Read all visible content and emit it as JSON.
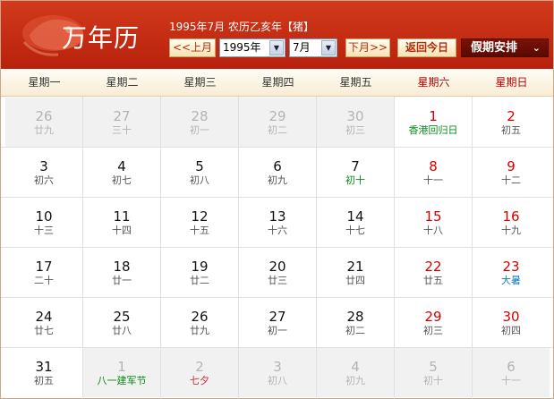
{
  "header": {
    "logo_text": "万年历",
    "info_line": "1995年7月 农历乙亥年【猪】",
    "prev_month_label": "<<上月",
    "year_select_value": "1995年",
    "month_select_value": "7月",
    "next_month_label": "下月>>",
    "today_label": "返回今日",
    "holiday_label": "假期安排"
  },
  "weekdays": [
    "星期一",
    "星期二",
    "星期三",
    "星期四",
    "星期五",
    "星期六",
    "星期日"
  ],
  "weeks": [
    [
      {
        "day": "26",
        "lunar": "廿九",
        "other": true
      },
      {
        "day": "27",
        "lunar": "三十",
        "other": true
      },
      {
        "day": "28",
        "lunar": "初一",
        "other": true
      },
      {
        "day": "29",
        "lunar": "初二",
        "other": true
      },
      {
        "day": "30",
        "lunar": "初三",
        "other": true
      },
      {
        "day": "1",
        "lunar": "香港回归日",
        "lunar_color": "green"
      },
      {
        "day": "2",
        "lunar": "初五"
      }
    ],
    [
      {
        "day": "3",
        "lunar": "初六"
      },
      {
        "day": "4",
        "lunar": "初七"
      },
      {
        "day": "5",
        "lunar": "初八"
      },
      {
        "day": "6",
        "lunar": "初九"
      },
      {
        "day": "7",
        "lunar": "初十",
        "lunar_color": "green"
      },
      {
        "day": "8",
        "lunar": "十一"
      },
      {
        "day": "9",
        "lunar": "十二"
      }
    ],
    [
      {
        "day": "10",
        "lunar": "十三"
      },
      {
        "day": "11",
        "lunar": "十四"
      },
      {
        "day": "12",
        "lunar": "十五"
      },
      {
        "day": "13",
        "lunar": "十六"
      },
      {
        "day": "14",
        "lunar": "十七"
      },
      {
        "day": "15",
        "lunar": "十八"
      },
      {
        "day": "16",
        "lunar": "十九"
      }
    ],
    [
      {
        "day": "17",
        "lunar": "二十"
      },
      {
        "day": "18",
        "lunar": "廿一"
      },
      {
        "day": "19",
        "lunar": "廿二"
      },
      {
        "day": "20",
        "lunar": "廿三"
      },
      {
        "day": "21",
        "lunar": "廿四"
      },
      {
        "day": "22",
        "lunar": "廿五"
      },
      {
        "day": "23",
        "lunar": "大暑",
        "lunar_color": "blue"
      }
    ],
    [
      {
        "day": "24",
        "lunar": "廿七"
      },
      {
        "day": "25",
        "lunar": "廿八"
      },
      {
        "day": "26",
        "lunar": "廿九"
      },
      {
        "day": "27",
        "lunar": "初一"
      },
      {
        "day": "28",
        "lunar": "初二"
      },
      {
        "day": "29",
        "lunar": "初三"
      },
      {
        "day": "30",
        "lunar": "初四"
      }
    ],
    [
      {
        "day": "31",
        "lunar": "初五"
      },
      {
        "day": "1",
        "lunar": "八一建军节",
        "other": true,
        "lunar_color": "green"
      },
      {
        "day": "2",
        "lunar": "七夕",
        "other": true,
        "lunar_color": "red"
      },
      {
        "day": "3",
        "lunar": "初八",
        "other": true
      },
      {
        "day": "4",
        "lunar": "初九",
        "other": true
      },
      {
        "day": "5",
        "lunar": "初十",
        "other": true
      },
      {
        "day": "6",
        "lunar": "十一",
        "other": true
      }
    ]
  ],
  "colors": {
    "header_red": "#c42a12",
    "weekend_red": "#d40000",
    "festival_green": "#0a8a1c",
    "solar_term_blue": "#1677c8",
    "other_month_gray": "#b4b4b4"
  }
}
